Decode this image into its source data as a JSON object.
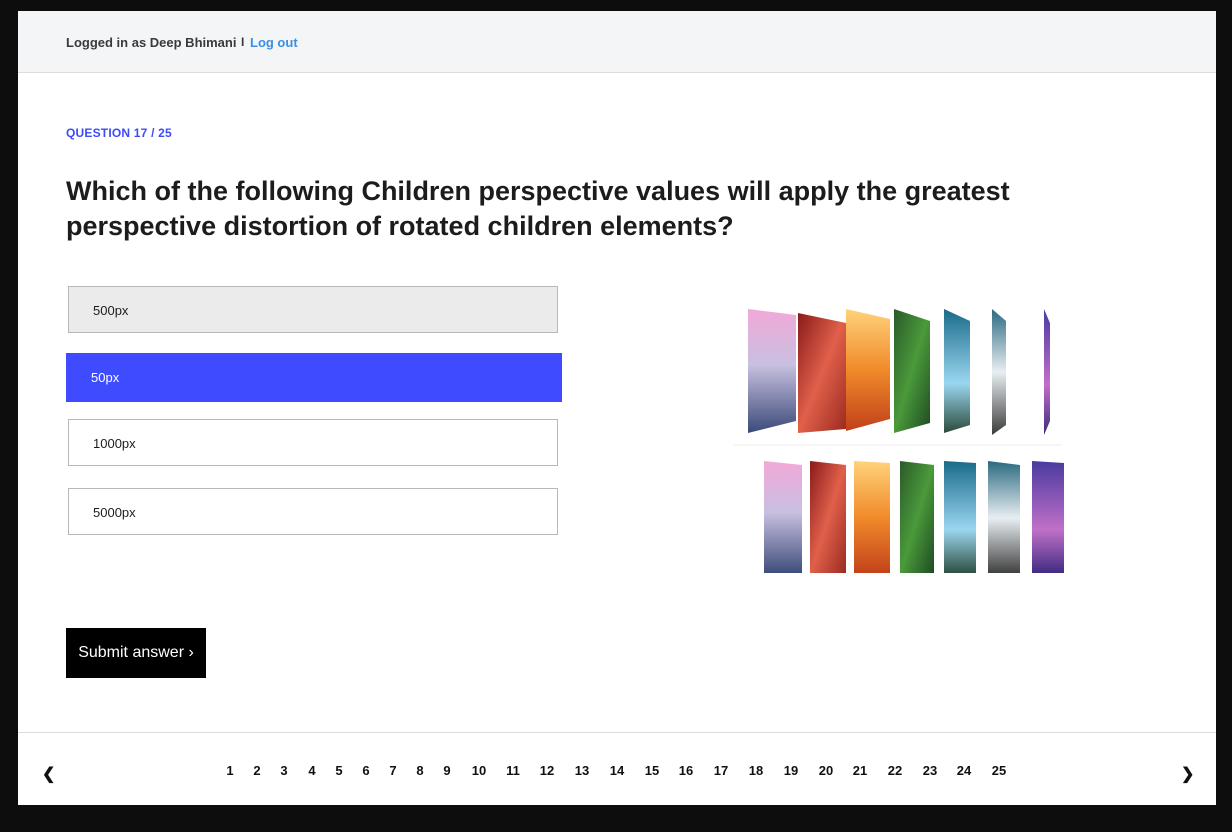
{
  "header": {
    "logged_in_text": "Logged in as Deep Bhimani",
    "separator": "I",
    "logout_label": "Log out",
    "link_color": "#3a8ee6"
  },
  "question": {
    "label": "QUESTION 17 / 25",
    "title": "Which of the following Children perspective values will apply the greatest perspective distortion of rotated children elements?",
    "accent_color": "#3d4cf5"
  },
  "options": [
    {
      "label": "500px",
      "state": "hover"
    },
    {
      "label": "50px",
      "state": "selected"
    },
    {
      "label": "1000px",
      "state": "default"
    },
    {
      "label": "5000px",
      "state": "default"
    }
  ],
  "submit": {
    "label": "Submit answer ›"
  },
  "pagination": {
    "prev_icon": "chevron-left-icon",
    "prev_glyph": "❮",
    "next_icon": "chevron-right-icon",
    "next_glyph": "❯",
    "pages": [
      "1",
      "2",
      "3",
      "4",
      "5",
      "6",
      "7",
      "8",
      "9",
      "10",
      "11",
      "12",
      "13",
      "14",
      "15",
      "16",
      "17",
      "18",
      "19",
      "20",
      "21",
      "22",
      "23",
      "24",
      "25"
    ]
  }
}
